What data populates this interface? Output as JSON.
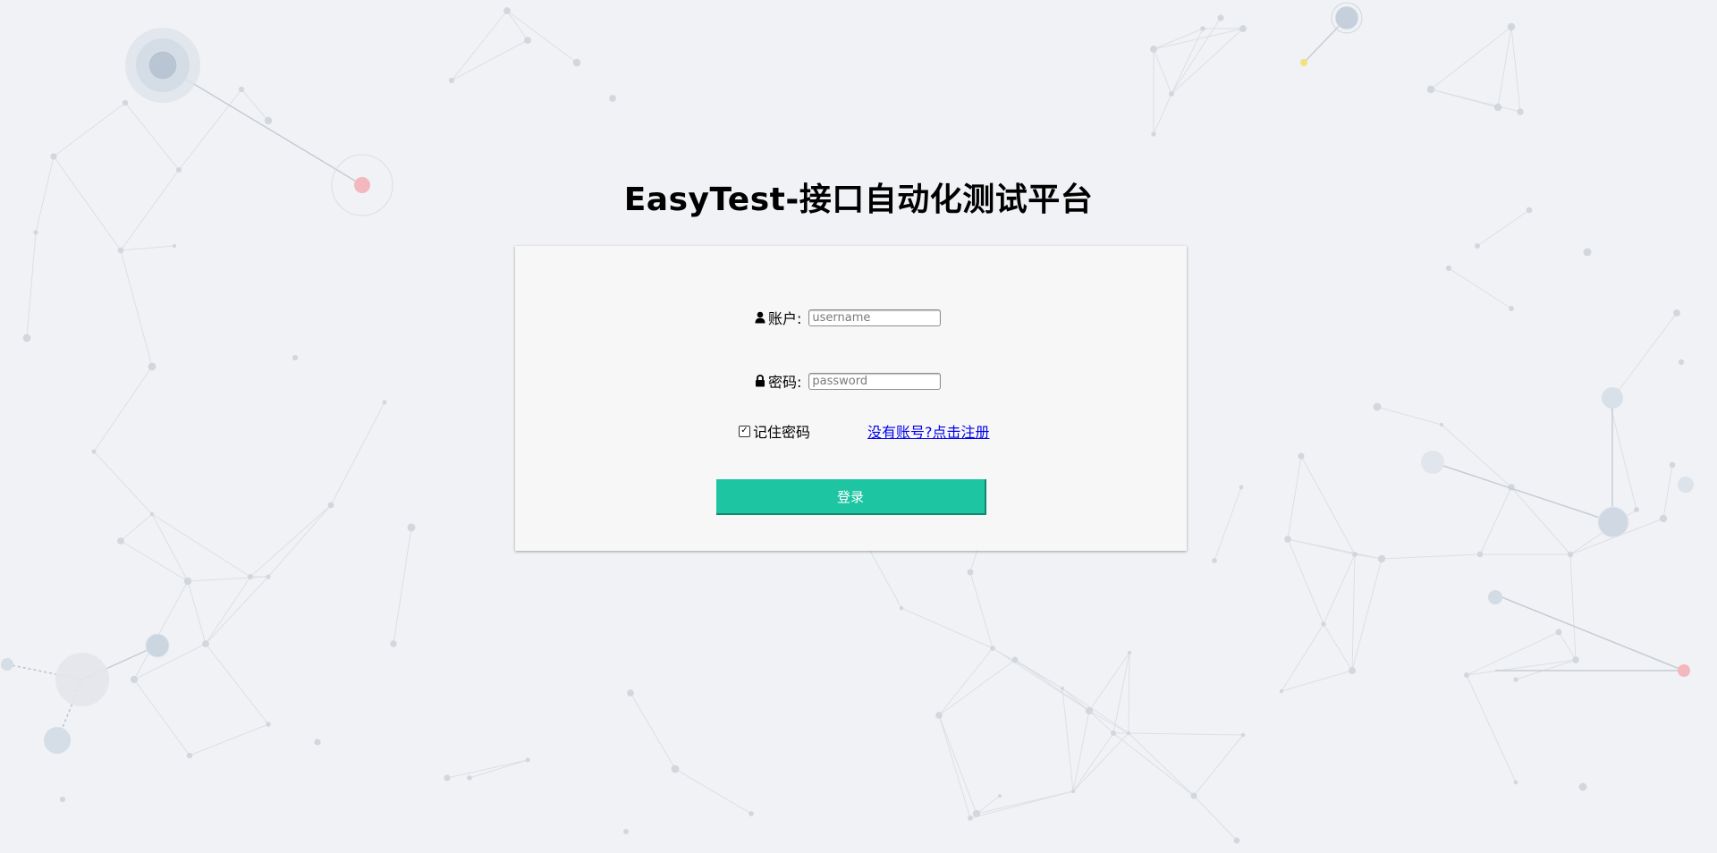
{
  "page": {
    "title": "EasyTest-接口自动化测试平台"
  },
  "login_form": {
    "username_label": "账户:",
    "username_placeholder": "username",
    "username_value": "",
    "password_label": "密码:",
    "password_placeholder": "password",
    "password_value": "",
    "remember_label": "记住密码",
    "remember_checked": true,
    "register_link": "没有账号?点击注册",
    "login_button": "登录"
  },
  "icons": {
    "user": "user-icon",
    "lock": "lock-icon",
    "checkbox": "checkbox-icon"
  },
  "colors": {
    "background": "#f1f2f5",
    "card": "#f7f7f7",
    "button": "#1dc5a3",
    "link": "#0000ee",
    "network_line": "#c9ced6",
    "network_node": "#c5ccd6",
    "accent_red": "#f2a7ad",
    "accent_yellow": "#f5e07a"
  }
}
